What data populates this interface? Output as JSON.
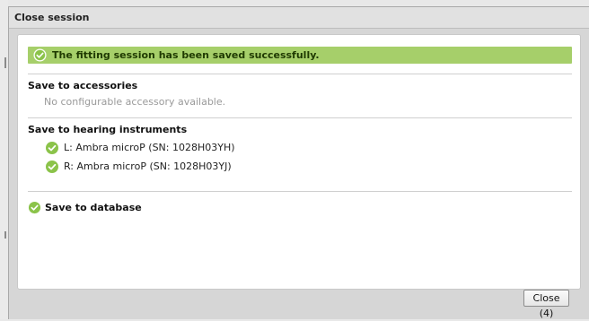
{
  "dialog": {
    "title": "Close session",
    "banner": {
      "icon": "check-circle-icon",
      "text": "The fitting session has been saved successfully.",
      "color": "#a6cf6a"
    },
    "accessories": {
      "heading": "Save to accessories",
      "message": "No configurable accessory available."
    },
    "instruments": {
      "heading": "Save to hearing instruments",
      "items": [
        {
          "label": "L: Ambra microP (SN: 1028H03YH)",
          "status_icon": "check-circle-icon"
        },
        {
          "label": "R: Ambra microP (SN: 1028H03YJ)",
          "status_icon": "check-circle-icon"
        }
      ]
    },
    "database": {
      "label": "Save to database",
      "status_icon": "check-circle-icon"
    },
    "close_button": "Close (4)"
  },
  "colors": {
    "success_green": "#a6cf6a",
    "check_green": "#8bc34a"
  }
}
